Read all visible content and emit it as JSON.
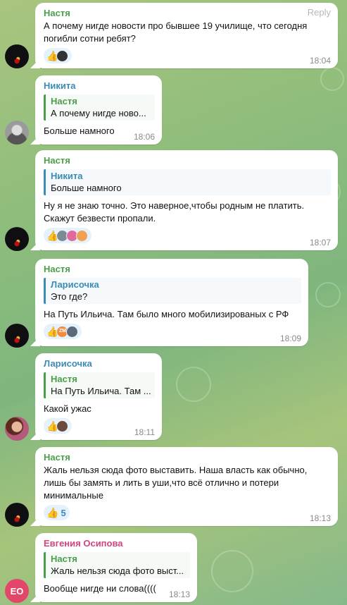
{
  "colors": {
    "green_name": "#4a9d4a",
    "blue_name": "#3a8bb5",
    "pink_name": "#d0457e",
    "bubble": "#ffffff",
    "time": "#8a8a8a",
    "reaction_bg": "#e6f2fb"
  },
  "messages": [
    {
      "sender": "Настя",
      "reply_action": "Reply",
      "text": "А почему нигде новости про бывшее 19 училище, что сегодня погибли сотни ребят?",
      "reaction_icon": "thumbs-up-icon",
      "time": "18:04"
    },
    {
      "sender": "Никита",
      "quote_name": "Настя",
      "quote_text": "А почему нигде ново...",
      "text": "Больше намного",
      "time": "18:06"
    },
    {
      "sender": "Настя",
      "quote_name": "Никита",
      "quote_text": "Больше намного",
      "text": "Ну я не знаю точно. Это наверное,чтобы родным не платить. Скажут безвести пропали.",
      "reaction_icon": "thumbs-up-icon",
      "time": "18:07"
    },
    {
      "sender": "Настя",
      "quote_name": "Ларисочка",
      "quote_text": "Это где?",
      "text": "На Путь Ильича. Там было много мобилизированых с РФ",
      "reaction_icon": "thumbs-up-icon",
      "mini_avatar_label": "ZM",
      "time": "18:09"
    },
    {
      "sender": "Ларисочка",
      "quote_name": "Настя",
      "quote_text": "На Путь Ильича. Там ...",
      "text": "Какой ужас",
      "reaction_icon": "thumbs-up-icon",
      "time": "18:11"
    },
    {
      "sender": "Настя",
      "text": "Жаль нельзя сюда фото выставить. Наша власть как обычно, лишь бы замять и лить в уши,что всё отлично и потери минимальные",
      "reaction_icon": "thumbs-up-icon",
      "reaction_count": "5",
      "time": "18:13"
    },
    {
      "sender": "Евгения Осипова",
      "avatar_initials": "ЕО",
      "quote_name": "Настя",
      "quote_text": "Жаль нельзя сюда фото выст...",
      "text": "Вообще нигде ни слова((((",
      "time": "18:13"
    }
  ]
}
